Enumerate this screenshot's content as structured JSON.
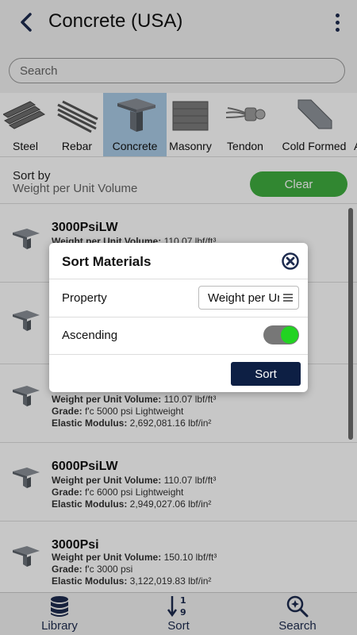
{
  "header": {
    "title": "Concrete (USA)"
  },
  "search": {
    "placeholder": "Search"
  },
  "categories": [
    {
      "label": "Steel"
    },
    {
      "label": "Rebar"
    },
    {
      "label": "Concrete",
      "selected": true
    },
    {
      "label": "Masonry"
    },
    {
      "label": "Tendon"
    },
    {
      "label": "Cold Formed"
    },
    {
      "label": "A"
    }
  ],
  "sortbar": {
    "label": "Sort by",
    "value": "Weight per Unit Volume",
    "clear_label": "Clear"
  },
  "materials": [
    {
      "name": "3000PsiLW",
      "wlabel": "Weight per Unit Volume:",
      "wval": " 110.07 lbf/ft³",
      "glabel": "",
      "gval": "",
      "elabel": "",
      "eval": ""
    },
    {
      "name": "",
      "wlabel": "",
      "wval": "",
      "glabel": "",
      "gval": "",
      "elabel": "",
      "eval": ""
    },
    {
      "name": "",
      "wlabel": "Weight per Unit Volume:",
      "wval": " 110.07 lbf/ft³",
      "glabel": "Grade:",
      "gval": " f'c 5000 psi Lightweight",
      "elabel": "Elastic Modulus:",
      "eval": " 2,692,081.16 lbf/in²"
    },
    {
      "name": "6000PsiLW",
      "wlabel": "Weight per Unit Volume:",
      "wval": " 110.07 lbf/ft³",
      "glabel": "Grade:",
      "gval": " f'c 6000 psi Lightweight",
      "elabel": "Elastic Modulus:",
      "eval": " 2,949,027.06 lbf/in²"
    },
    {
      "name": "3000Psi",
      "wlabel": "Weight per Unit Volume:",
      "wval": " 150.10 lbf/ft³",
      "glabel": "Grade:",
      "gval": " f'c 3000 psi",
      "elabel": "Elastic Modulus:",
      "eval": " 3,122,019.83 lbf/in²"
    }
  ],
  "tabs": [
    {
      "label": "Library",
      "icon": "database-icon"
    },
    {
      "label": "Sort",
      "icon": "sort-numeric-icon"
    },
    {
      "label": "Search",
      "icon": "search-icon"
    }
  ],
  "dialog": {
    "title": "Sort Materials",
    "property_label": "Property",
    "property_value": "Weight per Unit Volume",
    "ascending_label": "Ascending",
    "ascending": true,
    "sort_label": "Sort"
  },
  "colors": {
    "accent": "#3fae3f",
    "toggle_on": "#22d322",
    "primary": "#0d1f44",
    "selected": "#a9cbe6"
  }
}
